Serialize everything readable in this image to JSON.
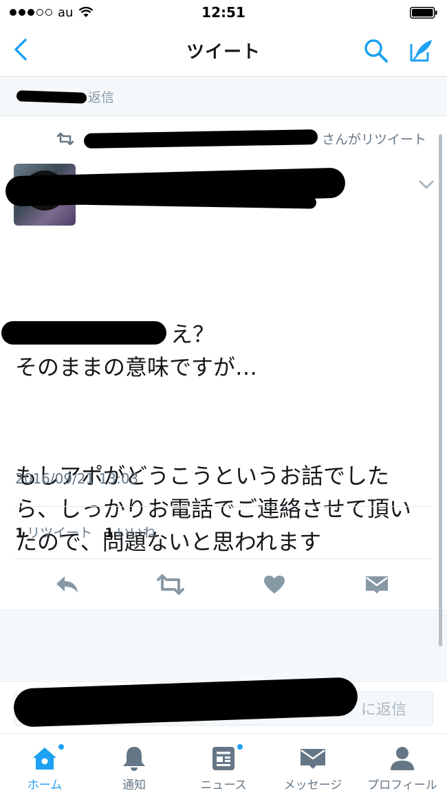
{
  "status_bar": {
    "carrier": "au",
    "time": "12:51"
  },
  "nav": {
    "title": "ツイート"
  },
  "reply_context": {
    "text": "返信"
  },
  "tweet": {
    "retweet_suffix": "さんがリツイート",
    "text_line1": "え？",
    "text_line2": "そのままの意味ですが…",
    "text_para2": "もしアポがどうこうというお話でしたら、しっかりお電話でご連絡させて頂いたので、問題ないと思われます",
    "timestamp": "2016/09/21 13:03",
    "retweet_count": "1",
    "retweet_label": "リツイート",
    "like_count": "1",
    "like_label": "いいね"
  },
  "reply_bar": {
    "placeholder_suffix": "に返信"
  },
  "tabs": [
    {
      "label": "ホーム",
      "icon": "home-icon",
      "active": true,
      "badge": true
    },
    {
      "label": "通知",
      "icon": "bell-icon",
      "active": false,
      "badge": false
    },
    {
      "label": "ニュース",
      "icon": "news-icon",
      "active": false,
      "badge": true
    },
    {
      "label": "メッセージ",
      "icon": "mail-icon",
      "active": false,
      "badge": false
    },
    {
      "label": "プロフィール",
      "icon": "person-icon",
      "active": false,
      "badge": false
    }
  ],
  "colors": {
    "accent": "#1da1f2",
    "muted": "#657786",
    "action": "#8899a6"
  }
}
